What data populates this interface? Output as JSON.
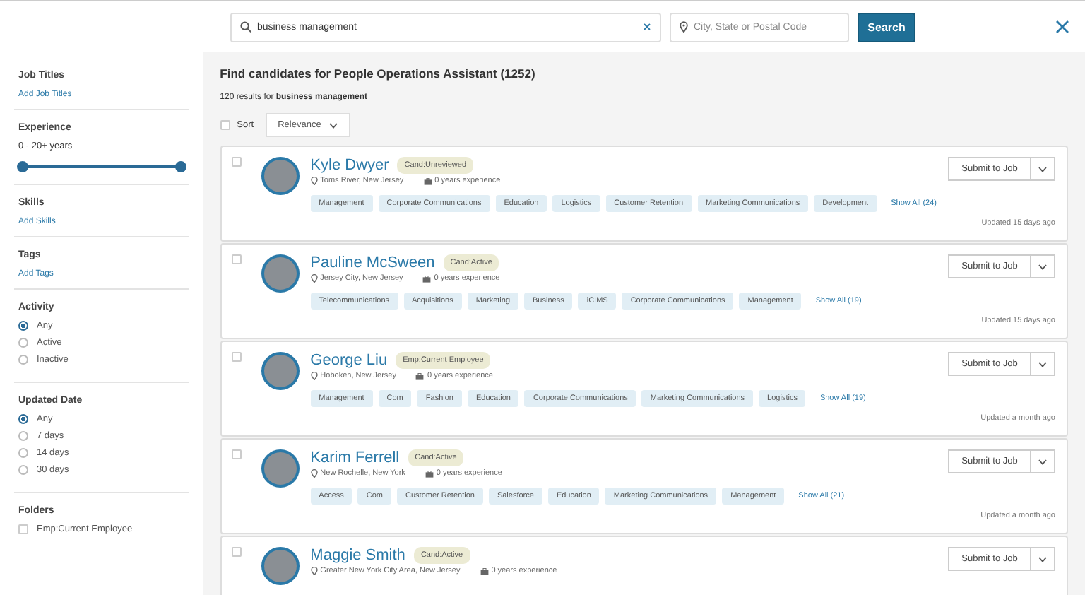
{
  "search": {
    "query": "business management",
    "location_placeholder": "City, State or Postal Code",
    "button": "Search"
  },
  "sidebar": {
    "sections": [
      {
        "kind": "link",
        "title": "Job Titles",
        "link": "Add Job Titles"
      },
      {
        "kind": "range",
        "title": "Experience",
        "reading": "0 - 20+ years",
        "level": 1
      },
      {
        "kind": "link",
        "title": "Skills",
        "link": "Add Skills"
      },
      {
        "kind": "link",
        "title": "Tags",
        "link": "Add Tags"
      },
      {
        "kind": "radio",
        "title": "Activity",
        "options": [
          {
            "label": "Any",
            "selected": true
          },
          {
            "label": "Active",
            "selected": false
          },
          {
            "label": "Inactive",
            "selected": false
          }
        ]
      },
      {
        "kind": "radio",
        "title": "Updated Date",
        "options": [
          {
            "label": "Any",
            "selected": true
          },
          {
            "label": "7 days",
            "selected": false
          },
          {
            "label": "14 days",
            "selected": false
          },
          {
            "label": "30 days",
            "selected": false
          }
        ]
      },
      {
        "kind": "check",
        "title": "Folders",
        "options": [
          {
            "label": "Emp:Current Employee",
            "checked": false
          }
        ]
      }
    ]
  },
  "main": {
    "heading": "Find candidates for People Operations Assistant (1252)",
    "results": "120 results for **business management**",
    "sort_label": "Sort",
    "sort_checked": false,
    "sort_value": "Relevance",
    "candidates": [
      {
        "name": "Kyle Dwyer",
        "status": "Cand:Unreviewed",
        "location": "Toms River, New Jersey",
        "experience": "0 years experience",
        "tags": [
          "Management",
          "Corporate Communications",
          "Education",
          "Logistics",
          "Customer Retention",
          "Marketing Communications",
          "Development"
        ],
        "show_all": "Show All (24)",
        "updated": "Updated 15 days ago",
        "button": "Submit to Job",
        "checked": false
      },
      {
        "name": "Pauline McSween",
        "status": "Cand:Active",
        "location": "Jersey City, New Jersey",
        "experience": "0 years experience",
        "tags": [
          "Telecommunications",
          "Acquisitions",
          "Marketing",
          "Business",
          "iCIMS",
          "Corporate Communications",
          "Management"
        ],
        "show_all": "Show All (19)",
        "updated": "Updated 15 days ago",
        "button": "Submit to Job",
        "checked": false
      },
      {
        "name": "George Liu",
        "status": "Emp:Current Employee",
        "location": "Hoboken, New Jersey",
        "experience": "0 years experience",
        "tags": [
          "Management",
          "Com",
          "Fashion",
          "Education",
          "Corporate Communications",
          "Marketing Communications",
          "Logistics"
        ],
        "show_all": "Show All (19)",
        "updated": "Updated a month ago",
        "button": "Submit to Job",
        "checked": false
      },
      {
        "name": "Karim Ferrell",
        "status": "Cand:Active",
        "location": "New Rochelle, New York",
        "experience": "0 years experience",
        "tags": [
          "Access",
          "Com",
          "Customer Retention",
          "Salesforce",
          "Education",
          "Marketing Communications",
          "Management"
        ],
        "show_all": "Show All (21)",
        "updated": "Updated a month ago",
        "button": "Submit to Job",
        "checked": false
      },
      {
        "name": "Maggie Smith",
        "status": "Cand:Active",
        "location": "Greater New York City Area, New Jersey",
        "experience": "0 years experience",
        "button": "Submit to Job",
        "checked": false
      }
    ]
  }
}
